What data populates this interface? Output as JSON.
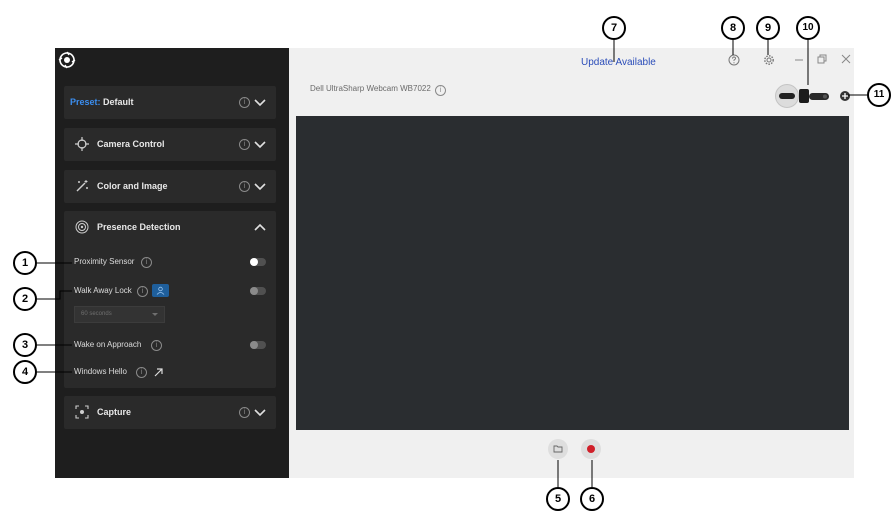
{
  "sidebar": {
    "sections": {
      "preset": {
        "label": "Preset:",
        "value": "Default"
      },
      "camera_control": {
        "label": "Camera Control"
      },
      "color_image": {
        "label": "Color and Image"
      },
      "presence_detection": {
        "label": "Presence Detection"
      },
      "capture": {
        "label": "Capture"
      }
    },
    "presence": {
      "proximity_sensor": {
        "label": "Proximity Sensor",
        "enabled": true
      },
      "walk_away_lock": {
        "label": "Walk Away Lock",
        "enabled": false,
        "timeout": "60 seconds"
      },
      "wake_on_approach": {
        "label": "Wake on Approach",
        "enabled": false
      },
      "windows_hello": {
        "label": "Windows Hello"
      }
    }
  },
  "header": {
    "update_text": "Update Available",
    "device_name": "Dell UltraSharp Webcam WB7022"
  },
  "callouts": [
    "1",
    "2",
    "3",
    "4",
    "5",
    "6",
    "7",
    "8",
    "9",
    "10",
    "11"
  ],
  "colors": {
    "accent": "#3b8ef0",
    "record": "#d0202a",
    "link": "#2b4db9"
  }
}
